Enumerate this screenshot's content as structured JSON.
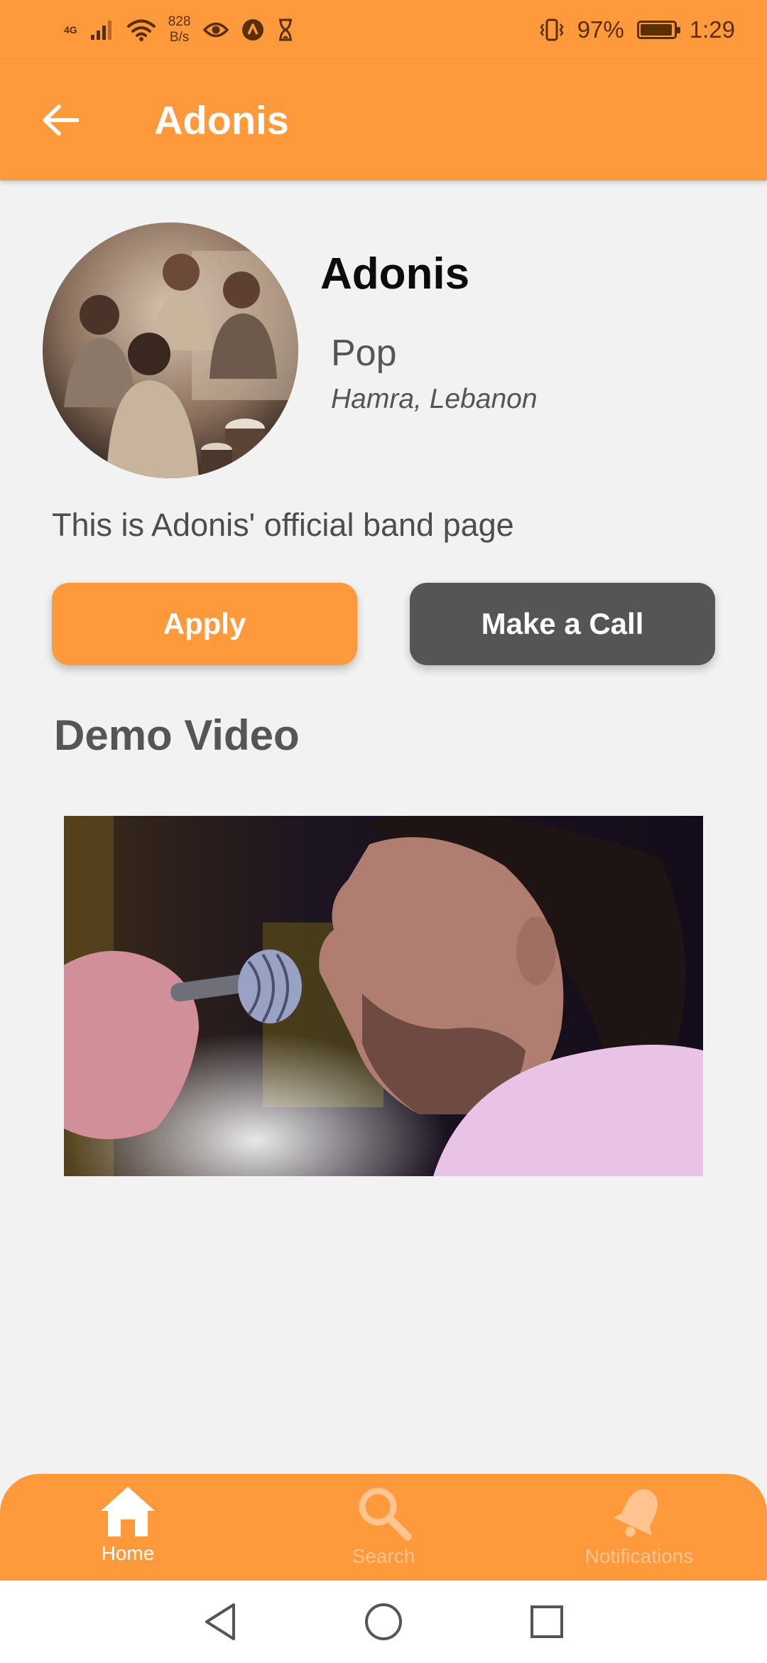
{
  "status_bar": {
    "network": "4G",
    "speed_value": "828",
    "speed_unit": "B/s",
    "battery": "97%",
    "battery_level": 0.97,
    "time": "1:29"
  },
  "app_bar": {
    "title": "Adonis",
    "back_icon": "arrow-left-icon"
  },
  "profile": {
    "name": "Adonis",
    "genre": "Pop",
    "location": "Hamra, Lebanon",
    "description": "This is Adonis' official band page"
  },
  "actions": {
    "apply_label": "Apply",
    "call_label": "Make a Call"
  },
  "demo": {
    "title": "Demo Video"
  },
  "bottom_nav": {
    "items": [
      {
        "label": "Home",
        "icon": "home-icon",
        "active": true
      },
      {
        "label": "Search",
        "icon": "search-icon",
        "active": false
      },
      {
        "label": "Notifications",
        "icon": "bell-icon",
        "active": false
      }
    ]
  },
  "colors": {
    "accent": "#ff9a3c",
    "secondary_button": "#555555",
    "background": "#f2f2f2"
  }
}
